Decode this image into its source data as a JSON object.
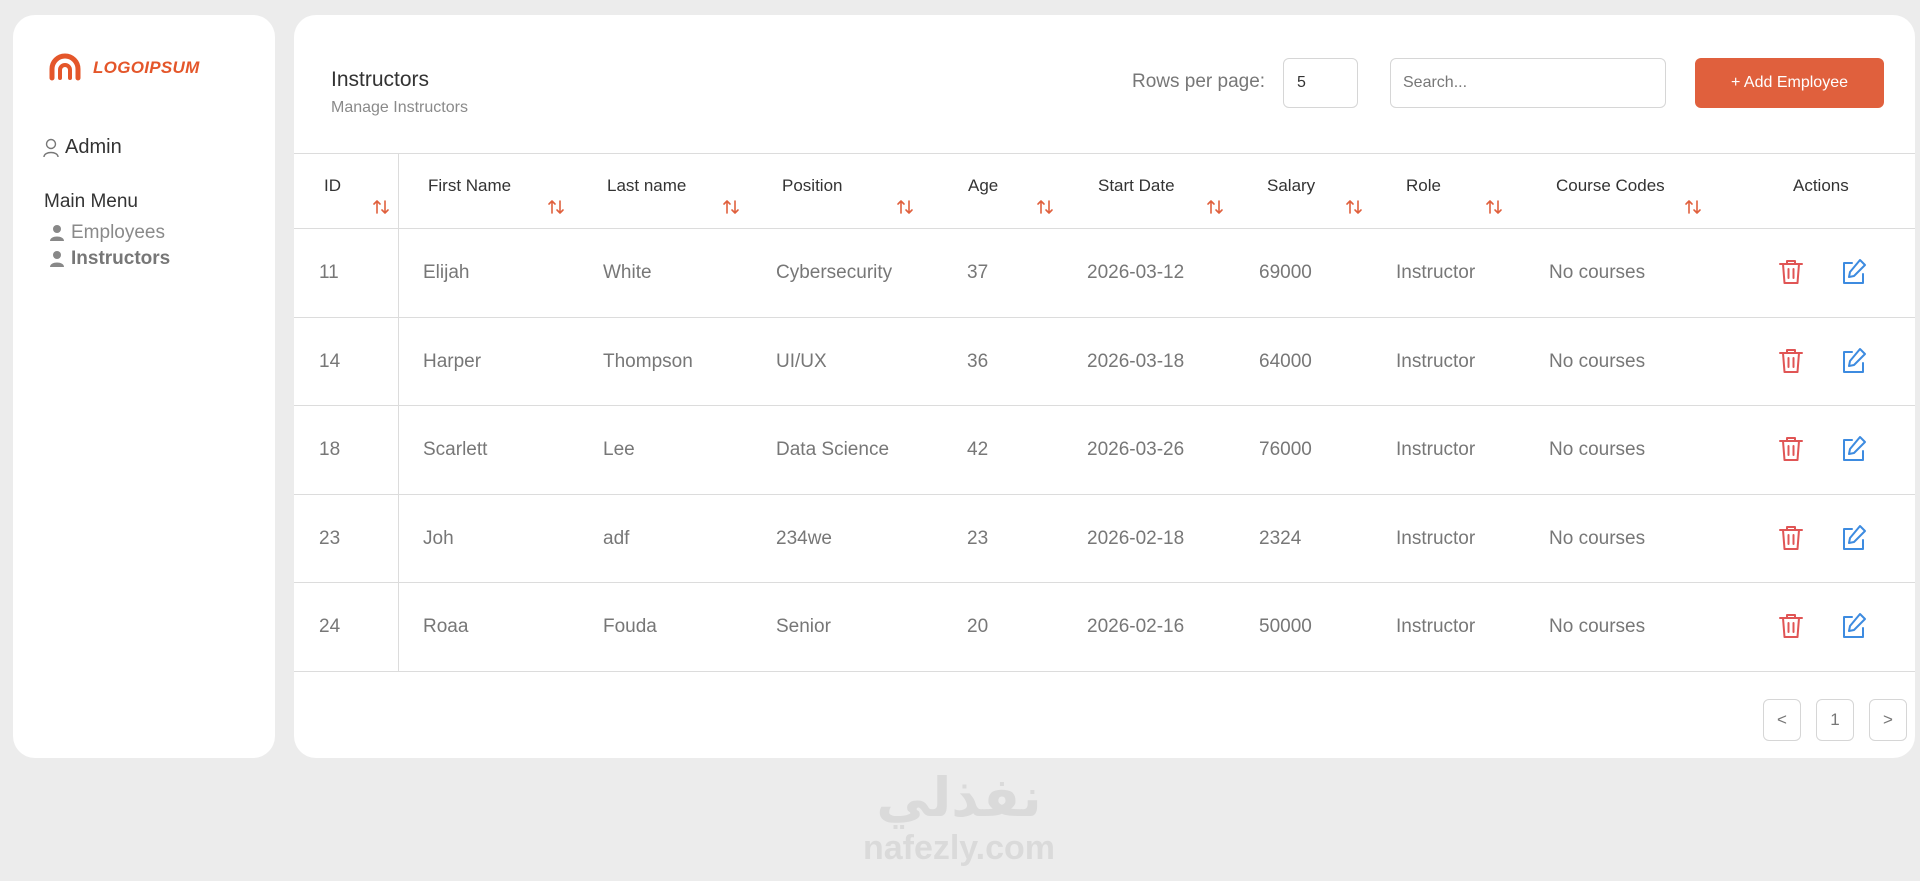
{
  "brand": {
    "logo_text": "LOGOIPSUM",
    "accent": "#e0603d"
  },
  "user": {
    "name": "Admin"
  },
  "sidebar": {
    "menu_title": "Main Menu",
    "items": [
      {
        "label": "Employees",
        "active": false
      },
      {
        "label": "Instructors",
        "active": true
      }
    ]
  },
  "header": {
    "title": "Instructors",
    "subtitle": "Manage Instructors",
    "rows_per_page_label": "Rows per page:",
    "rows_per_page_value": "5",
    "search_placeholder": "Search...",
    "add_button_label": "+ Add Employee"
  },
  "table": {
    "columns": [
      "ID",
      "First Name",
      "Last name",
      "Position",
      "Age",
      "Start Date",
      "Salary",
      "Role",
      "Course Codes",
      "Actions"
    ],
    "rows": [
      [
        "11",
        "Elijah",
        "White",
        "Cybersecurity",
        "37",
        "2026-03-12",
        "69000",
        "Instructor",
        "No courses"
      ],
      [
        "14",
        "Harper",
        "Thompson",
        "UI/UX",
        "36",
        "2026-03-18",
        "64000",
        "Instructor",
        "No courses"
      ],
      [
        "18",
        "Scarlett",
        "Lee",
        "Data Science",
        "42",
        "2026-03-26",
        "76000",
        "Instructor",
        "No courses"
      ],
      [
        "23",
        "Joh",
        "adf",
        "234we",
        "23",
        "2026-02-18",
        "2324",
        "Instructor",
        "No courses"
      ],
      [
        "24",
        "Roaa",
        "Fouda",
        "Senior",
        "20",
        "2026-02-16",
        "50000",
        "Instructor",
        "No courses"
      ]
    ]
  },
  "pagination": {
    "prev": "<",
    "current": "1",
    "next": ">"
  },
  "watermark": {
    "arabic": "نفذلي",
    "latin": "nafezly.com"
  }
}
